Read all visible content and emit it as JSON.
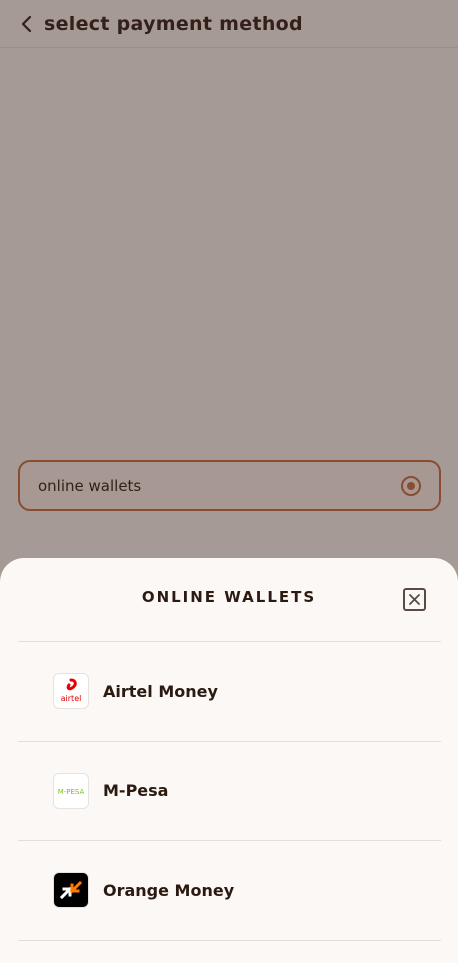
{
  "header": {
    "title": "select payment method"
  },
  "method": {
    "label": "online wallets"
  },
  "sheet": {
    "title": "ONLINE WALLETS",
    "items": [
      {
        "label": "Airtel Money",
        "icon": "airtel-logo",
        "logo_text": "airtel",
        "color": "#e40000"
      },
      {
        "label": "M-Pesa",
        "icon": "mpesa-logo",
        "logo_text": "M-PESA",
        "color": "#7cbf26"
      },
      {
        "label": "Orange Money",
        "icon": "orange-money-logo",
        "color": "#ff7900"
      }
    ]
  },
  "colors": {
    "accent": "#c96a3a",
    "text": "#2b1a12",
    "scrim": "rgba(60,40,35,0.45)"
  }
}
